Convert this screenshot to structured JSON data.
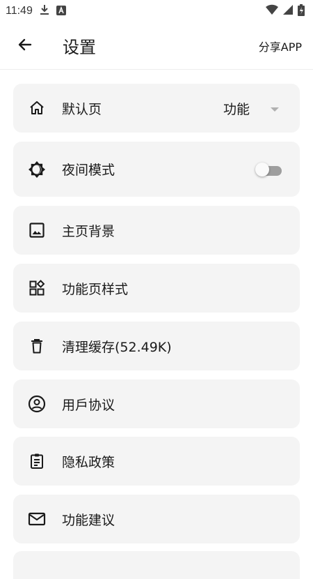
{
  "status_bar": {
    "time": "11:49",
    "icons": [
      "download-icon",
      "app-store-icon",
      "wifi-icon",
      "signal-icon",
      "battery-icon"
    ]
  },
  "app_bar": {
    "title": "设置",
    "share_label": "分享APP"
  },
  "settings": {
    "items": [
      {
        "label": "默认页",
        "icon": "home-icon",
        "value": "功能"
      },
      {
        "label": "夜间模式",
        "icon": "night-mode-icon",
        "toggle_on": false
      },
      {
        "label": "主页背景",
        "icon": "image-icon"
      },
      {
        "label": "功能页样式",
        "icon": "widgets-icon"
      },
      {
        "label": "清理缓存(52.49K)",
        "icon": "trash-icon"
      },
      {
        "label": "用戶协议",
        "icon": "account-circle-icon"
      },
      {
        "label": "隐私政策",
        "icon": "clipboard-icon"
      },
      {
        "label": "功能建议",
        "icon": "mail-icon"
      }
    ]
  },
  "colors": {
    "card_bg": "#f4f4f4",
    "text": "#1a1a1a",
    "toggle_track_off": "#9e9e9e"
  }
}
